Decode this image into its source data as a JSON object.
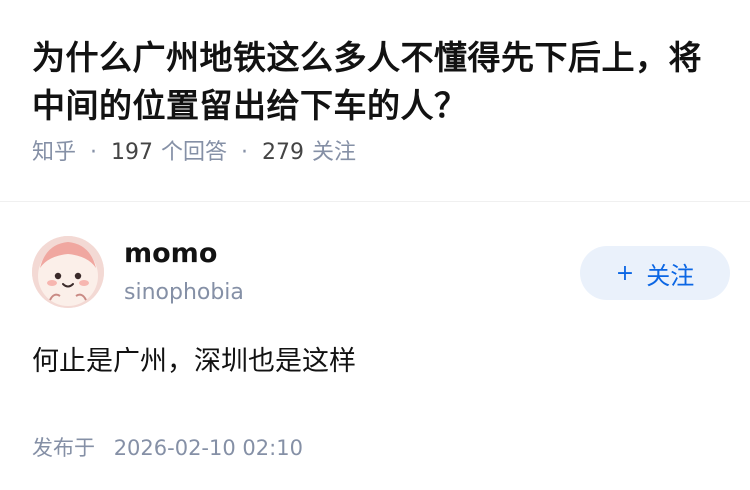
{
  "question": {
    "title": "为什么广州地铁这么多人不懂得先下后上，将中间的位置留出给下车的人？",
    "source": "知乎",
    "answer_count": "197",
    "answer_label": "个回答",
    "follower_count": "279",
    "follower_label": "关注"
  },
  "answer": {
    "author_name": "momo",
    "author_bio": "sinophobia",
    "follow_plus": "+",
    "follow_label": "关注",
    "content": "何止是广州，深圳也是这样",
    "publish_label": "发布于",
    "publish_time": "2026-02-10 02:10"
  },
  "colors": {
    "accent": "#0b66e4",
    "follow_bg": "#eaf1fb",
    "meta_gray": "#8590a6"
  },
  "icons": {
    "avatar": "cartoon-face-avatar"
  }
}
